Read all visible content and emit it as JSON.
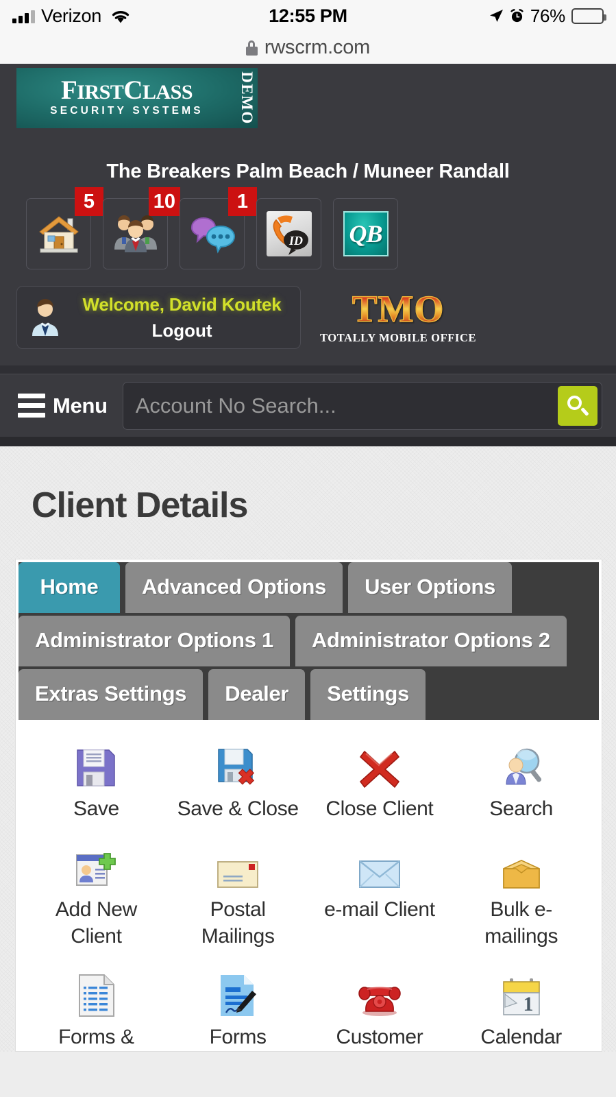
{
  "status_bar": {
    "carrier": "Verizon",
    "time": "12:55 PM",
    "battery_percent": "76%",
    "battery_level": 76,
    "icons": [
      "signal-bars-icon",
      "wifi-icon",
      "location-arrow-icon",
      "alarm-clock-icon",
      "battery-icon"
    ]
  },
  "browser": {
    "url": "rwscrm.com",
    "lock_icon": "lock-icon"
  },
  "header": {
    "logo": {
      "line1_part1": "F",
      "line1_small1": "IRST",
      "line1_part2": "C",
      "line1_small2": "LASS",
      "line2": "SECURITY SYSTEMS",
      "demo": "DEMO"
    },
    "client_title": "The Breakers Palm Beach / Muneer Randall",
    "quick_icons": [
      {
        "name": "house-icon",
        "badge": "5"
      },
      {
        "name": "people-group-icon",
        "badge": "10"
      },
      {
        "name": "chat-bubbles-icon",
        "badge": "1"
      },
      {
        "name": "caller-id-icon",
        "badge": ""
      },
      {
        "name": "quickbooks-icon",
        "badge": "",
        "label": "QB"
      }
    ],
    "welcome": "Welcome, David Koutek",
    "logout": "Logout",
    "tmo": {
      "main": "TMO",
      "sub": "TOTALLY MOBILE OFFICE"
    }
  },
  "menu_bar": {
    "menu_label": "Menu",
    "search_placeholder": "Account No Search...",
    "search_value": "",
    "search_button_icon": "search-icon"
  },
  "main": {
    "page_heading": "Client Details",
    "tab_rows": [
      [
        {
          "label": "Home",
          "active": true
        },
        {
          "label": "Advanced Options",
          "active": false
        },
        {
          "label": "User Options",
          "active": false
        }
      ],
      [
        {
          "label": "Administrator Options 1",
          "active": false
        },
        {
          "label": "Administrator Options 2",
          "active": false
        }
      ],
      [
        {
          "label": "Extras Settings",
          "active": false
        },
        {
          "label": "Dealer",
          "active": false
        },
        {
          "label": "Settings",
          "active": false
        }
      ]
    ],
    "actions": [
      {
        "label": "Save",
        "icon": "floppy-disk-icon"
      },
      {
        "label": "Save & Close",
        "icon": "floppy-disk-close-icon"
      },
      {
        "label": "Close Client",
        "icon": "red-x-icon"
      },
      {
        "label": "Search",
        "icon": "person-search-icon"
      },
      {
        "label": "Add New Client",
        "icon": "add-contact-card-icon"
      },
      {
        "label": "Postal Mailings",
        "icon": "envelope-stamp-icon"
      },
      {
        "label": "e-mail Client",
        "icon": "blue-envelope-icon"
      },
      {
        "label": "Bulk e-mailings",
        "icon": "mail-box-icon"
      },
      {
        "label": "Forms &",
        "icon": "document-list-icon"
      },
      {
        "label": "Forms",
        "icon": "signed-document-icon"
      },
      {
        "label": "Customer",
        "icon": "red-telephone-icon"
      },
      {
        "label": "Calendar",
        "icon": "calendar-icon"
      }
    ]
  },
  "colors": {
    "header_dark": "#3a3a3f",
    "accent_teal": "#3a9aae",
    "search_green": "#b5cc1a",
    "badge_red": "#cc1111",
    "welcome_yellow": "#d2e02a",
    "logo_teal": "#1d6a66"
  }
}
